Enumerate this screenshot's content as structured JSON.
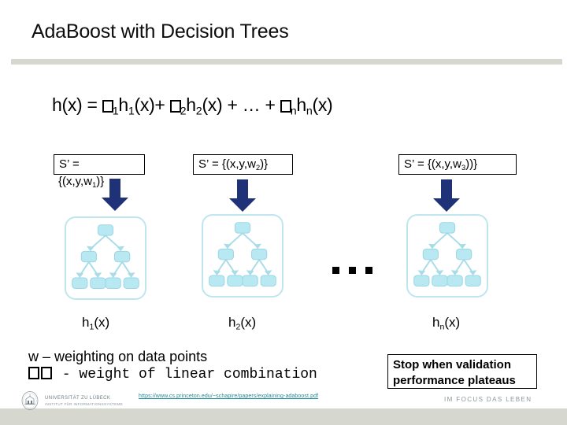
{
  "slide": {
    "title": "AdaBoost with Decision Trees",
    "formula": {
      "lhs": "h(x) = ",
      "term1_sub": "1",
      "term1_h": "h",
      "term1_arg": "(x)+ ",
      "term2_sub": "2",
      "term2_h": "h",
      "term2_arg": "(x) + ",
      "ellipsis": "…  + ",
      "termn_sub": "n",
      "termn_h": "h",
      "termn_arg": "(x)"
    },
    "sample_boxes": [
      {
        "name": "sample-box-1",
        "line1": "S’ = ",
        "line2_pre": "{(x,y,w",
        "line2_sub": "1",
        "line2_post": ")}"
      },
      {
        "name": "sample-box-2",
        "line1_pre": "S’ = {(x,y,w",
        "line1_sub": "2",
        "line1_post": ")}"
      },
      {
        "name": "sample-box-3",
        "line1_pre": "S’ = {(x,y,w",
        "line1_sub": "3",
        "line1_post": "))}"
      }
    ],
    "tree_labels": [
      {
        "h": "h",
        "sub": "1",
        "arg": "(x)"
      },
      {
        "h": "h",
        "sub": "2",
        "arg": "(x)"
      },
      {
        "h": "h",
        "sub": "n",
        "arg": "(x)"
      }
    ],
    "ellipsis_between_trees": "■ ■ ■",
    "legend": {
      "line1": "w – weighting on data points",
      "line2_suffix": " - weight of linear combination"
    },
    "stop_box": {
      "line1": "Stop when validation",
      "line2": "performance plateaus"
    },
    "paper_link": "https://www.cs.princeton.edu/~schapire/papers/explaining-adaboost.pdf",
    "footer": {
      "university": "UNIVERSITÄT ZU LÜBECK",
      "institute": "INSTITUT FÜR INFORMATIONSSYSTEME",
      "tagline": "IM FOCUS DAS LEBEN"
    },
    "colors": {
      "rule": "#d6d8cf",
      "arrow": "#1f3177",
      "tree_node": "#b8e8f2",
      "tree_border": "#bfe6ee",
      "link": "#1f8a99"
    }
  }
}
